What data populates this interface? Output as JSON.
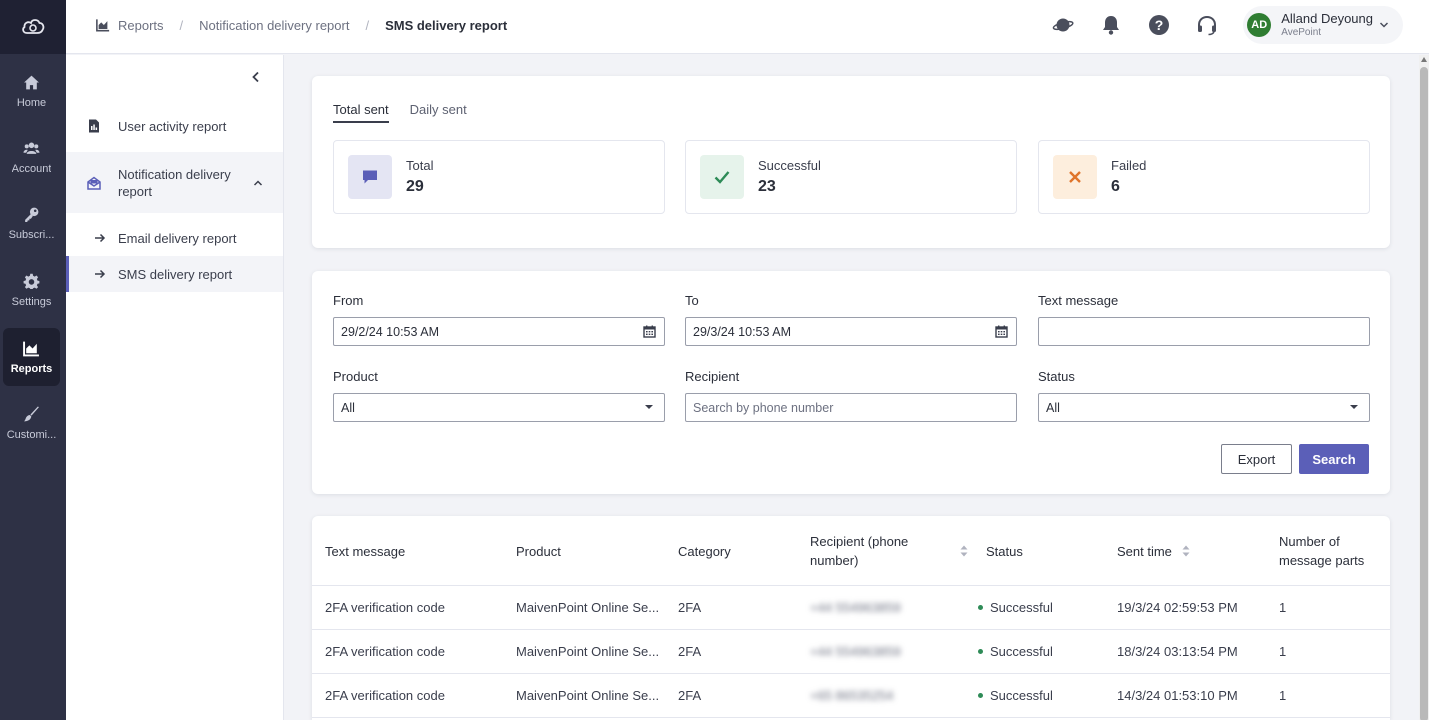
{
  "rail": {
    "items": [
      {
        "label": "Home",
        "icon": "home-icon"
      },
      {
        "label": "Account",
        "icon": "users-icon"
      },
      {
        "label": "Subscri...",
        "icon": "key-icon"
      },
      {
        "label": "Settings",
        "icon": "gear-icon"
      },
      {
        "label": "Reports",
        "icon": "chart-icon"
      },
      {
        "label": "Customi...",
        "icon": "brush-icon"
      }
    ]
  },
  "breadcrumb": {
    "items": [
      "Reports",
      "Notification delivery report",
      "SMS delivery report"
    ],
    "separator": "/"
  },
  "user": {
    "initials": "AD",
    "name": "Alland Deyoung",
    "org": "AvePoint"
  },
  "subnav": {
    "user_activity": "User activity report",
    "notification_delivery": "Notification delivery report",
    "email_delivery": "Email delivery report",
    "sms_delivery": "SMS delivery report"
  },
  "summary": {
    "tabs": [
      "Total sent",
      "Daily sent"
    ],
    "stats": [
      {
        "label": "Total",
        "value": "29"
      },
      {
        "label": "Successful",
        "value": "23"
      },
      {
        "label": "Failed",
        "value": "6"
      }
    ]
  },
  "filters": {
    "from_label": "From",
    "from_value": "29/2/24 10:53 AM",
    "to_label": "To",
    "to_value": "29/3/24 10:53 AM",
    "text_label": "Text message",
    "text_value": "",
    "product_label": "Product",
    "product_value": "All",
    "recipient_label": "Recipient",
    "recipient_placeholder": "Search by phone number",
    "status_label": "Status",
    "status_value": "All",
    "export_label": "Export",
    "search_label": "Search"
  },
  "table": {
    "headers": [
      "Text message",
      "Product",
      "Category",
      "Recipient (phone number)",
      "Status",
      "Sent time",
      "Number of message parts"
    ],
    "rows": [
      {
        "text": "2FA verification code",
        "product": "MaivenPoint Online Se...",
        "category": "2FA",
        "recipient": "+44 554963859",
        "status": "Successful",
        "sent": "19/3/24 02:59:53 PM",
        "parts": "1"
      },
      {
        "text": "2FA verification code",
        "product": "MaivenPoint Online Se...",
        "category": "2FA",
        "recipient": "+44 554963859",
        "status": "Successful",
        "sent": "18/3/24 03:13:54 PM",
        "parts": "1"
      },
      {
        "text": "2FA verification code",
        "product": "MaivenPoint Online Se...",
        "category": "2FA",
        "recipient": "+65 86535254",
        "status": "Successful",
        "sent": "14/3/24 01:53:10 PM",
        "parts": "1"
      }
    ]
  },
  "colors": {
    "accent": "#5b5fb8",
    "rail": "#2e3145",
    "success": "#2e8b57",
    "failed": "#e0742a"
  }
}
